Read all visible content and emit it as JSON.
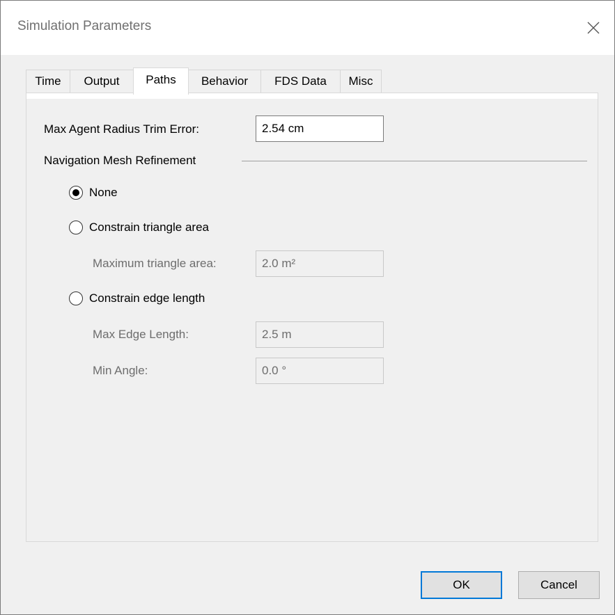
{
  "window": {
    "title": "Simulation Parameters"
  },
  "tabs": [
    {
      "label": "Time"
    },
    {
      "label": "Output"
    },
    {
      "label": "Paths"
    },
    {
      "label": "Behavior"
    },
    {
      "label": "FDS Data"
    },
    {
      "label": "Misc"
    }
  ],
  "active_tab": "Paths",
  "paths": {
    "trim_error": {
      "label": "Max Agent Radius Trim Error:",
      "value": "2.54 cm"
    },
    "refinement_group": "Navigation Mesh Refinement",
    "options": {
      "none": {
        "label": "None",
        "selected": true
      },
      "triangle": {
        "label": "Constrain triangle area",
        "selected": false
      },
      "edge": {
        "label": "Constrain edge length",
        "selected": false
      }
    },
    "max_triangle_area": {
      "label": "Maximum triangle area:",
      "value": "2.0 m²",
      "enabled": false
    },
    "max_edge_length": {
      "label": "Max Edge Length:",
      "value": "2.5 m",
      "enabled": false
    },
    "min_angle": {
      "label": "Min Angle:",
      "value": "0.0 °",
      "enabled": false
    }
  },
  "buttons": {
    "ok": "OK",
    "cancel": "Cancel"
  },
  "colors": {
    "accent": "#0078d7",
    "disabled_text": "#6d6d6d"
  },
  "icons": {
    "close": "close-icon"
  }
}
